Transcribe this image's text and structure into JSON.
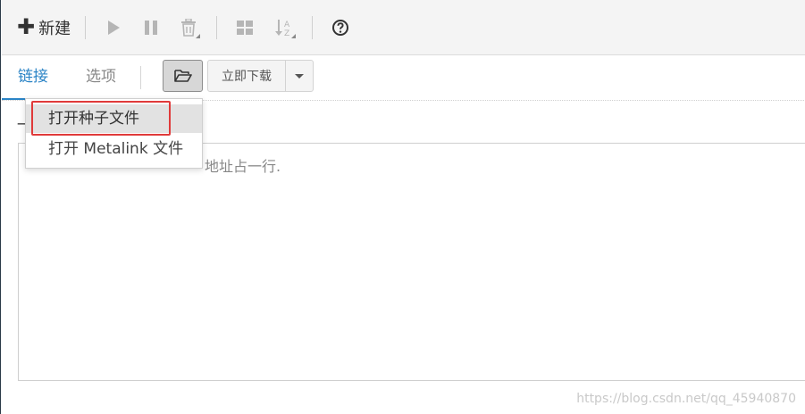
{
  "toolbar": {
    "new_label": "新建",
    "icons": [
      "plus-icon",
      "play-icon",
      "pause-icon",
      "trash-icon",
      "grid-icon",
      "sort-az-icon",
      "help-icon"
    ]
  },
  "tabs": {
    "link_label": "链接",
    "options_label": "选项",
    "download_label": "立即下载"
  },
  "content": {
    "hint_fragment": "一",
    "textarea_placeholder_visible": "地址占一行."
  },
  "menu": {
    "items": [
      {
        "label": "打开种子文件"
      },
      {
        "label": "打开 Metalink 文件"
      }
    ]
  },
  "watermark": "https://blog.csdn.net/qq_45940870",
  "colors": {
    "accent": "#2b84c6",
    "highlight": "#e03a3a",
    "menu_hover": "#e2e2e2"
  }
}
